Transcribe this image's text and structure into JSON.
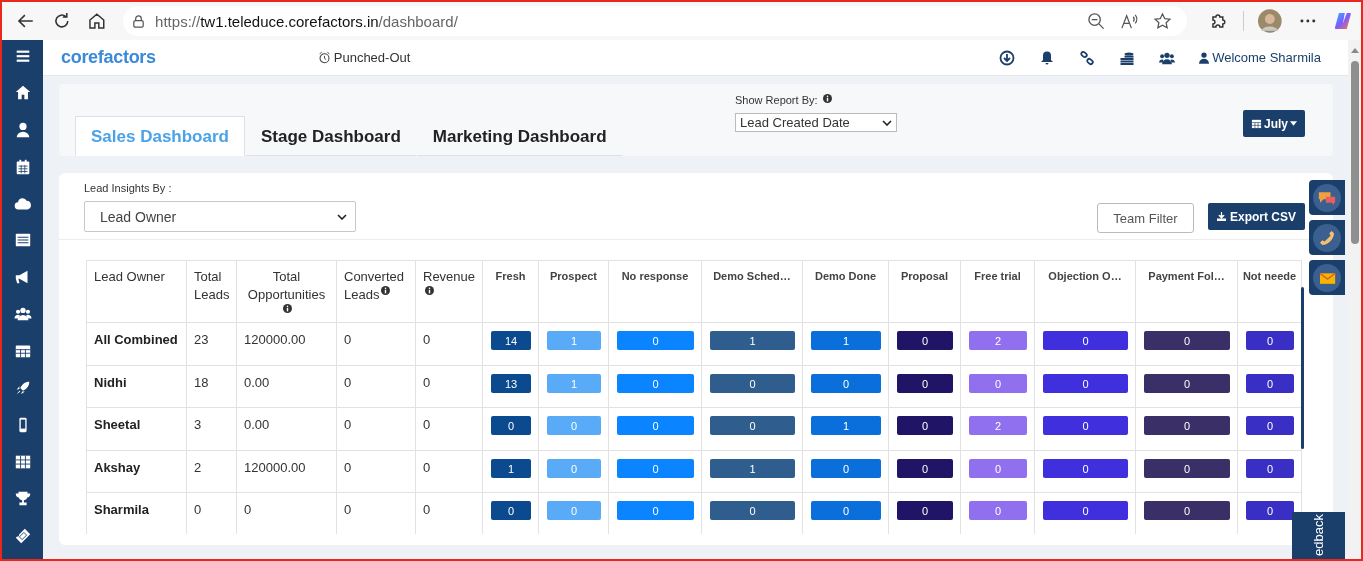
{
  "browser": {
    "url_scheme": "https://",
    "url_host": "tw1.teleduce.corefactors.in",
    "url_path": "/dashboard/"
  },
  "header": {
    "logo": "corefactors",
    "punch_status": "Punched-Out",
    "welcome": "Welcome Sharmila"
  },
  "tabs": [
    {
      "label": "Sales Dashboard",
      "selected": true
    },
    {
      "label": "Stage Dashboard",
      "selected": false
    },
    {
      "label": "Marketing Dashboard",
      "selected": false
    }
  ],
  "report_by": {
    "label": "Show Report By:",
    "value": "Lead Created Date"
  },
  "month_button": "July",
  "insights": {
    "label": "Lead Insights By :",
    "value": "Lead Owner"
  },
  "buttons": {
    "team_filter": "Team Filter",
    "export": "Export CSV"
  },
  "table": {
    "columns": [
      {
        "label": "Lead Owner",
        "info": false
      },
      {
        "label": "Total Leads",
        "info": false
      },
      {
        "label": "Total Opportunities",
        "info": true
      },
      {
        "label": "Converted Leads",
        "info": true
      },
      {
        "label": "Revenue",
        "info": true
      }
    ],
    "stage_columns": [
      {
        "label": "Fresh",
        "color": "#0b4a8f"
      },
      {
        "label": "Prospect",
        "color": "#5aabf7"
      },
      {
        "label": "No response",
        "color": "#0a84ff"
      },
      {
        "label": "Demo Sched…",
        "color": "#2f5e8e"
      },
      {
        "label": "Demo Done",
        "color": "#0a6fdb"
      },
      {
        "label": "Proposal",
        "color": "#1f1466"
      },
      {
        "label": "Free trial",
        "color": "#9170f0"
      },
      {
        "label": "Objection O…",
        "color": "#3f2fdc"
      },
      {
        "label": "Payment Fol…",
        "color": "#3a2f66"
      },
      {
        "label": "Not neede",
        "color": "#3a2fc4"
      }
    ],
    "rows": [
      {
        "cells": [
          "All Combined",
          "23",
          "120000.00",
          "0",
          "0"
        ],
        "stages": [
          "14",
          "1",
          "0",
          "1",
          "1",
          "0",
          "2",
          "0",
          "0",
          "0"
        ]
      },
      {
        "cells": [
          "Nidhi",
          "18",
          "0.00",
          "0",
          "0"
        ],
        "stages": [
          "13",
          "1",
          "0",
          "0",
          "0",
          "0",
          "0",
          "0",
          "0",
          "0"
        ]
      },
      {
        "cells": [
          "Sheetal",
          "3",
          "0.00",
          "0",
          "0"
        ],
        "stages": [
          "0",
          "0",
          "0",
          "0",
          "1",
          "0",
          "2",
          "0",
          "0",
          "0"
        ]
      },
      {
        "cells": [
          "Akshay",
          "2",
          "120000.00",
          "0",
          "0"
        ],
        "stages": [
          "1",
          "0",
          "0",
          "1",
          "0",
          "0",
          "0",
          "0",
          "0",
          "0"
        ]
      },
      {
        "cells": [
          "Sharmila",
          "0",
          "0",
          "0",
          "0"
        ],
        "stages": [
          "0",
          "0",
          "0",
          "0",
          "0",
          "0",
          "0",
          "0",
          "0",
          "0"
        ]
      }
    ]
  },
  "feedback": "edback"
}
